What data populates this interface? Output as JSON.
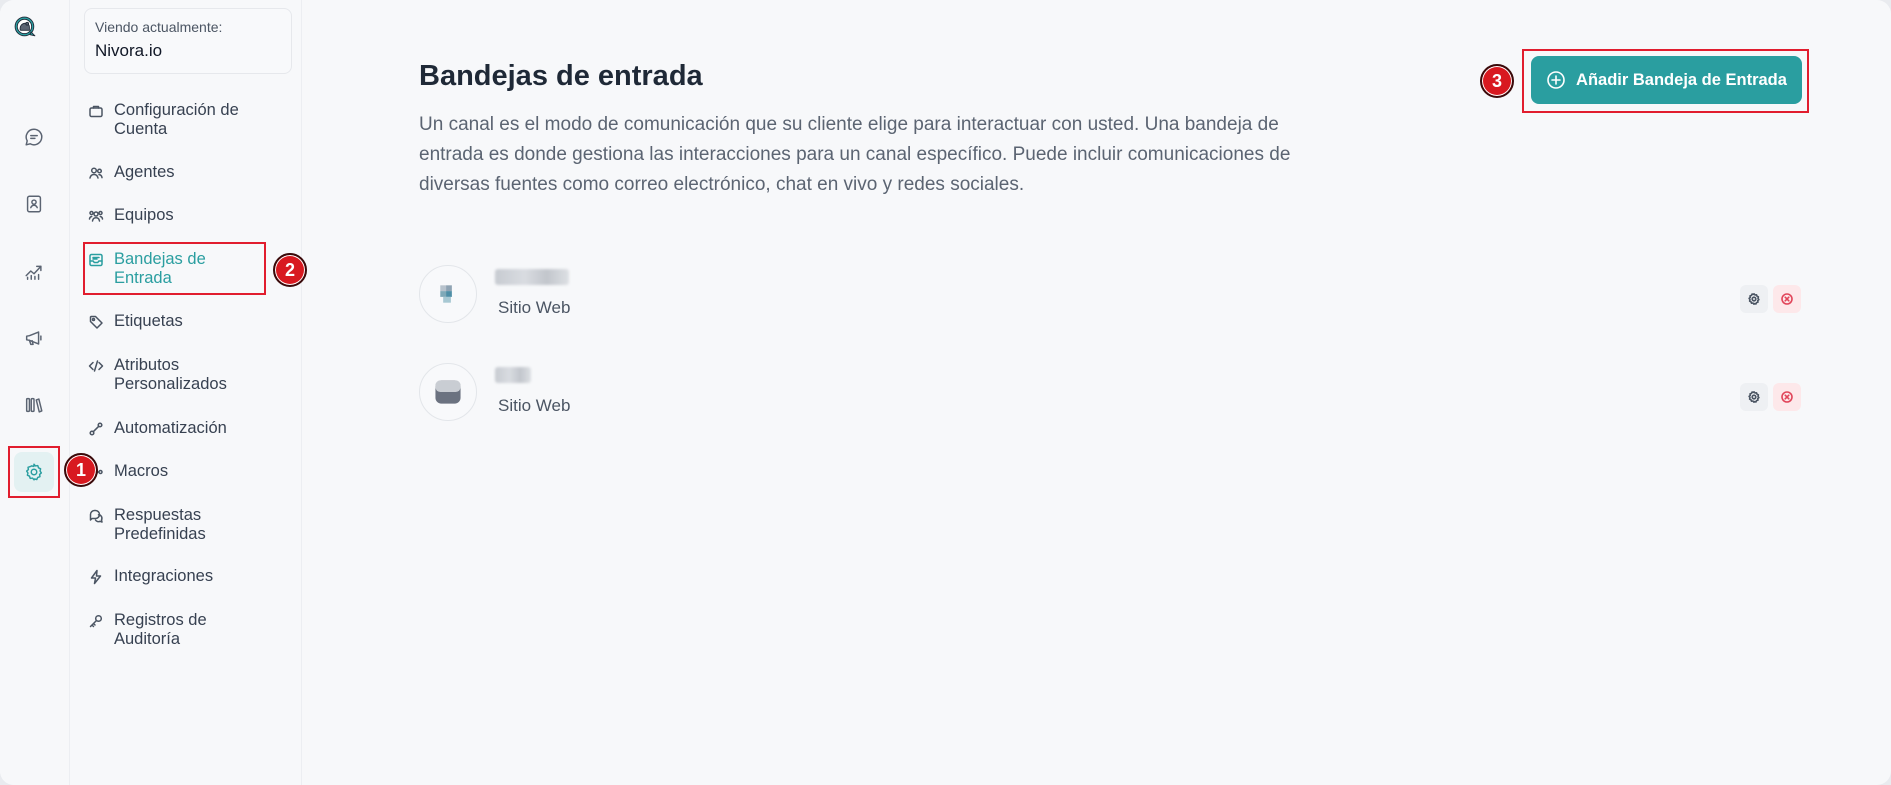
{
  "account": {
    "viewing_label": "Viendo actualmente:",
    "name": "Nivora.io"
  },
  "rail": {
    "items": [
      {
        "icon": "chat-bubble-icon"
      },
      {
        "icon": "contacts-icon"
      },
      {
        "icon": "reports-icon"
      },
      {
        "icon": "campaigns-megaphone-icon"
      },
      {
        "icon": "library-icon"
      },
      {
        "icon": "settings-gear-icon"
      }
    ]
  },
  "sidebar": {
    "items": [
      {
        "label": "Configuración de Cuenta",
        "icon": "briefcase-icon"
      },
      {
        "label": "Agentes",
        "icon": "people-icon"
      },
      {
        "label": "Equipos",
        "icon": "team-icon"
      },
      {
        "label": "Bandejas de Entrada",
        "icon": "inbox-icon",
        "active": true
      },
      {
        "label": "Etiquetas",
        "icon": "tag-icon"
      },
      {
        "label": "Atributos Personalizados",
        "icon": "code-icon"
      },
      {
        "label": "Automatización",
        "icon": "automation-icon"
      },
      {
        "label": "Macros",
        "icon": "macros-icon"
      },
      {
        "label": "Respuestas Predefinidas",
        "icon": "chat-multiple-icon"
      },
      {
        "label": "Integraciones",
        "icon": "flash-icon"
      },
      {
        "label": "Registros de Auditoría",
        "icon": "key-icon"
      }
    ]
  },
  "main": {
    "title": "Bandejas de entrada",
    "description": "Un canal es el modo de comunicación que su cliente elige para interactuar con usted. Una bandeja de entrada es donde gestiona las interacciones para un canal específico. Puede incluir comunicaciones de diversas fuentes como correo electrónico, chat en vivo y redes sociales.",
    "add_button_label": "Añadir Bandeja de Entrada",
    "inboxes": [
      {
        "type": "Sitio Web"
      },
      {
        "type": "Sitio Web"
      }
    ]
  },
  "annotations": [
    "1",
    "2",
    "3"
  ],
  "colors": {
    "accent": "#2a9ea0",
    "annotation_red": "#e11d2e"
  }
}
